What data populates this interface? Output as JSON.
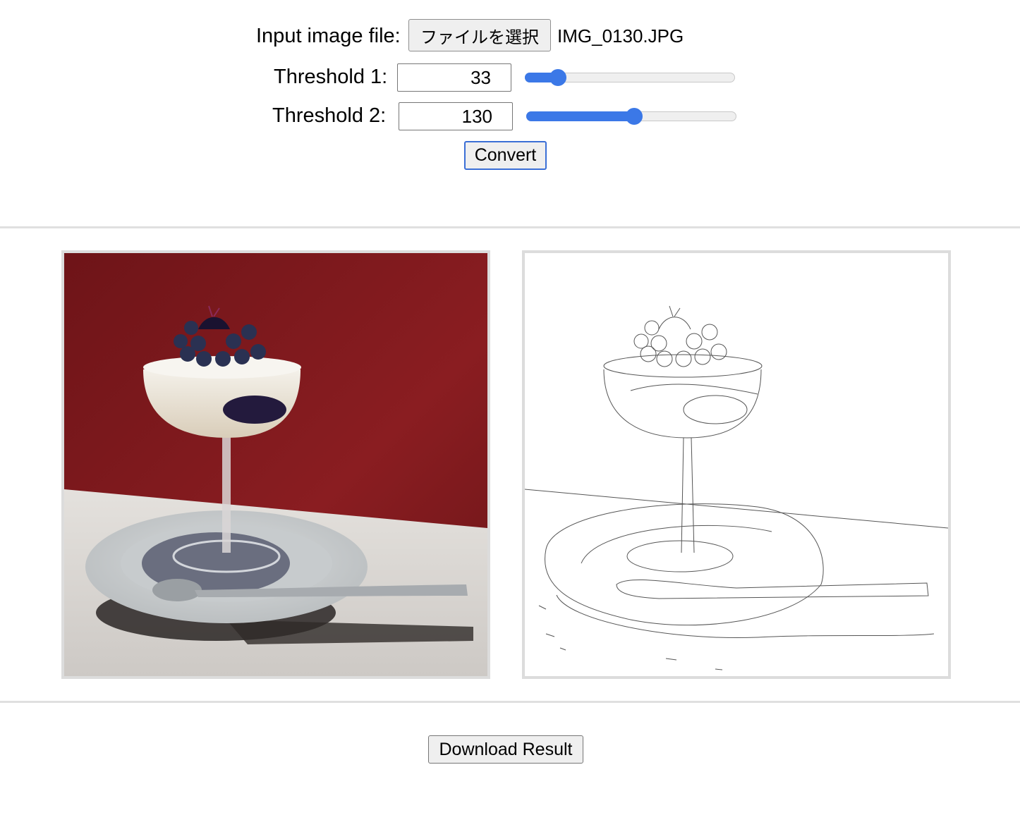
{
  "form": {
    "file_label": "Input image file:",
    "file_button_label": "ファイルを選択",
    "file_name": "IMG_0130.JPG",
    "threshold1_label": "Threshold 1:",
    "threshold1_value": "33",
    "threshold1_slider_fraction": 0.155,
    "threshold2_label": "Threshold 2:",
    "threshold2_value": "130",
    "threshold2_slider_fraction": 0.51,
    "convert_label": "Convert"
  },
  "images": {
    "input_image": "photo-of-blueberry-parfait-on-plate",
    "output_image": "edge-detected-line-drawing"
  },
  "download_label": "Download Result",
  "colors": {
    "accent": "#3b78e7",
    "photo_wall": "#7d1a1e",
    "photo_table": "#dcd8d4",
    "divider": "#e0e0e0"
  }
}
